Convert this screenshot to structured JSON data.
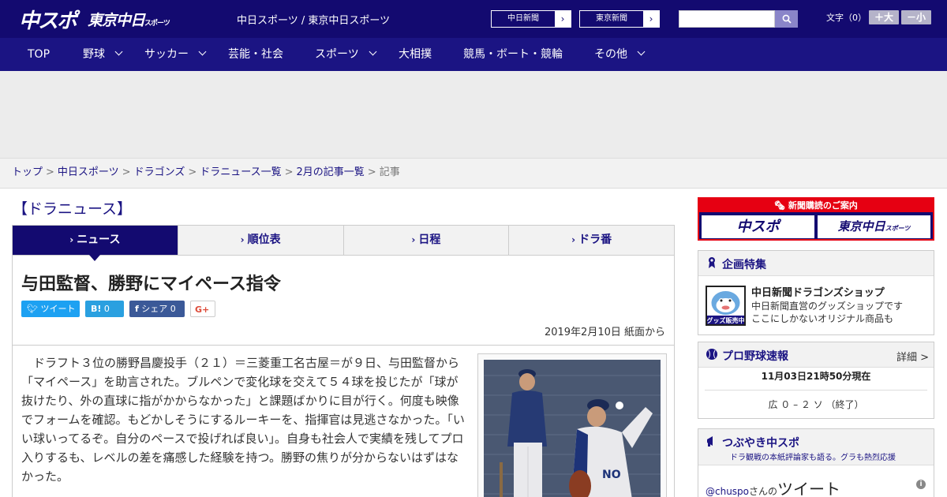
{
  "header": {
    "logo_chuspo": "中スポ",
    "logo_tokyo": "東京中日",
    "logo_tokyo_small": "スポーツ",
    "site_title": "中日スポーツ / 東京中日スポーツ",
    "paper_links": [
      "中日新聞",
      "東京新聞"
    ],
    "search": {
      "placeholder": "",
      "icon": "search-icon"
    },
    "fontsize_label": "文字（0）",
    "fontsize_up": "＋大",
    "fontsize_down": "－小"
  },
  "nav": {
    "items": [
      {
        "label": "TOP",
        "dropdown": false
      },
      {
        "label": "野球",
        "dropdown": true
      },
      {
        "label": "サッカー",
        "dropdown": true
      },
      {
        "label": "芸能・社会",
        "dropdown": false
      },
      {
        "label": "スポーツ",
        "dropdown": true
      },
      {
        "label": "大相撲",
        "dropdown": false
      },
      {
        "label": "競馬・ボート・競輪",
        "dropdown": false
      },
      {
        "label": "その他",
        "dropdown": true
      }
    ]
  },
  "breadcrumb": {
    "items": [
      "トップ",
      "中日スポーツ",
      "ドラゴンズ",
      "ドラニュース一覧",
      "2月の記事一覧"
    ],
    "current": "記事"
  },
  "main": {
    "section_heading": "【ドラニュース】",
    "tabs": [
      {
        "label": "ニュース",
        "active": true
      },
      {
        "label": "順位表",
        "active": false
      },
      {
        "label": "日程",
        "active": false
      },
      {
        "label": "ドラ番",
        "active": false
      }
    ],
    "headline": "与田監督、勝野にマイペース指令",
    "share": {
      "tweet": "ツイート",
      "hatena": "0",
      "facebook": "シェア 0",
      "gplus": "G+"
    },
    "pubdate": "2019年2月10日 紙面から",
    "body": "ドラフト３位の勝野昌慶投手（２１）＝三菱重工名古屋＝が９日、与田監督から「マイペース」を助言された。ブルペンで変化球を交えて５４球を投じたが「球が抜けたり、外の直球に指がかからなかった」と課題ばかりに目が行く。何度も映像でフォームを確認。もどかしそうにするルーキーを、指揮官は見逃さなかった。「いい球いってるぞ。自分のペースで投げれば良い」。自身も社会人で実績を残してプロ入りするも、レベルの差を痛感した経験を持つ。勝野の焦りが分からないはずはなかった。"
  },
  "sidebar": {
    "subscribe": {
      "title": "新聞購読のご案内",
      "buttons": [
        "中スポ",
        "東京中日"
      ],
      "button_small": "スポーツ"
    },
    "feature": {
      "title": "企画特集",
      "shop_title": "中日新聞ドラゴンズショップ",
      "shop_desc_1": "中日新聞直営のグッズショップです",
      "shop_desc_2": "ここにしかないオリジナル商品も",
      "shop_logo_text": "グッズ販売中"
    },
    "scores": {
      "title": "プロ野球速報",
      "detail": "詳細 >",
      "timestamp": "11月03日21時50分現在",
      "game": "広 ０ – ２ ソ （終了）"
    },
    "tweets": {
      "title": "つぶやき中スポ",
      "subtitle": "ドラ観戦の本紙評論家も語る。グラも熱烈応援",
      "handle": "@chuspo",
      "handle_suffix": "さんの",
      "heading": "ツイート"
    }
  },
  "colors": {
    "brand_dark": "#130a70",
    "nav": "#1b1483",
    "accent_red": "#e60012",
    "twitter": "#1da1f2",
    "facebook": "#3b5998"
  }
}
